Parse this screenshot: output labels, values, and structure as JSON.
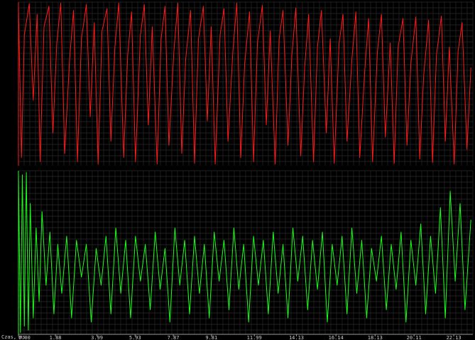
{
  "chart_data": [
    {
      "type": "line",
      "title": "",
      "ylabel": "",
      "xlabel": "Czas, ms",
      "color": "#ff1a1a",
      "xlim": [
        0,
        23.1
      ],
      "ylim": [
        -1,
        1
      ],
      "grid": true,
      "x_ticks": [
        0.0,
        1.88,
        3.99,
        5.93,
        7.87,
        9.81,
        11.99,
        14.13,
        16.14,
        18.13,
        20.11,
        22.13
      ],
      "x_tick_labels": [
        "0.00",
        "1.88",
        "3.99",
        "5.93",
        "7.87",
        "9.81",
        "11.99",
        "14.13",
        "16.14",
        "18.13",
        "20.11",
        "22.13"
      ],
      "series": [
        {
          "x": [
            0.0,
            0.15,
            0.3,
            0.55,
            0.75,
            0.95,
            1.1,
            1.3,
            1.55,
            1.75,
            1.95,
            2.15,
            2.35,
            2.6,
            2.8,
            3.0,
            3.2,
            3.45,
            3.65,
            3.85,
            4.05,
            4.25,
            4.5,
            4.7,
            4.9,
            5.1,
            5.35,
            5.55,
            5.75,
            5.95,
            6.2,
            6.4,
            6.6,
            6.8,
            7.05,
            7.25,
            7.45,
            7.65,
            7.9,
            8.1,
            8.3,
            8.5,
            8.75,
            8.95,
            9.15,
            9.4,
            9.6,
            9.8,
            10.0,
            10.25,
            10.45,
            10.65,
            10.9,
            11.1,
            11.3,
            11.5,
            11.75,
            11.95,
            12.15,
            12.4,
            12.6,
            12.8,
            13.05,
            13.25,
            13.45,
            13.7,
            13.9,
            14.1,
            14.35,
            14.55,
            14.75,
            15.0,
            15.2,
            15.4,
            15.65,
            15.85,
            16.05,
            16.3,
            16.5,
            16.7,
            16.95,
            17.15,
            17.35,
            17.6,
            17.8,
            18.0,
            18.25,
            18.45,
            18.65,
            18.9,
            19.1,
            19.3,
            19.55,
            19.75,
            19.95,
            20.2,
            20.4,
            20.6,
            20.85,
            21.05,
            21.25,
            21.5,
            21.7,
            21.9,
            22.15,
            22.35,
            22.55,
            22.8,
            23.0
          ],
          "y": [
            0.95,
            -0.9,
            0.6,
            0.98,
            -0.2,
            0.85,
            -0.95,
            0.7,
            0.95,
            -0.6,
            0.5,
            0.99,
            -0.85,
            0.3,
            0.9,
            -0.95,
            0.55,
            0.97,
            -0.4,
            0.75,
            -0.98,
            0.65,
            0.92,
            -0.7,
            0.45,
            0.99,
            -0.9,
            0.35,
            0.88,
            -0.95,
            0.6,
            0.97,
            -0.5,
            0.7,
            -0.98,
            0.55,
            0.95,
            -0.75,
            0.4,
            0.99,
            -0.85,
            0.3,
            0.9,
            -0.97,
            0.55,
            0.95,
            -0.45,
            0.7,
            -0.98,
            0.6,
            0.92,
            -0.7,
            0.4,
            0.99,
            -0.9,
            0.25,
            0.88,
            -0.95,
            0.5,
            0.96,
            -0.5,
            0.65,
            -0.98,
            0.55,
            0.9,
            -0.75,
            0.35,
            0.93,
            -0.88,
            0.2,
            0.85,
            -0.95,
            0.45,
            0.9,
            -0.6,
            0.55,
            -0.97,
            0.5,
            0.85,
            -0.7,
            0.3,
            0.88,
            -0.9,
            0.15,
            0.8,
            -0.95,
            0.4,
            0.85,
            -0.65,
            0.5,
            -0.97,
            0.45,
            0.8,
            -0.75,
            0.25,
            0.82,
            -0.92,
            0.1,
            0.78,
            -0.96,
            0.35,
            0.83,
            -0.7,
            0.45,
            -0.98,
            0.4,
            0.75,
            -0.8,
            0.2
          ]
        }
      ]
    },
    {
      "type": "line",
      "title": "",
      "ylabel": "",
      "xlabel": "Czas, ms",
      "color": "#1aff1a",
      "xlim": [
        0,
        23.1
      ],
      "ylim": [
        -1,
        1
      ],
      "grid": true,
      "x_ticks": [
        0.0,
        1.88,
        3.99,
        5.93,
        7.87,
        9.81,
        11.99,
        14.13,
        16.14,
        18.13,
        20.11,
        22.13
      ],
      "x_tick_labels": [
        "0.00",
        "1.88",
        "3.99",
        "5.93",
        "7.87",
        "9.81",
        "11.99",
        "14.13",
        "16.14",
        "18.13",
        "20.11",
        "22.13"
      ],
      "series": [
        {
          "x": [
            0.0,
            0.1,
            0.2,
            0.3,
            0.4,
            0.5,
            0.6,
            0.75,
            0.9,
            1.05,
            1.2,
            1.4,
            1.6,
            1.8,
            2.0,
            2.2,
            2.45,
            2.7,
            2.95,
            3.2,
            3.45,
            3.7,
            3.95,
            4.2,
            4.45,
            4.7,
            4.95,
            5.2,
            5.45,
            5.7,
            5.95,
            6.2,
            6.45,
            6.7,
            6.95,
            7.2,
            7.45,
            7.7,
            7.95,
            8.2,
            8.45,
            8.7,
            8.95,
            9.2,
            9.45,
            9.7,
            9.95,
            10.2,
            10.45,
            10.7,
            10.95,
            11.2,
            11.45,
            11.7,
            11.95,
            12.2,
            12.45,
            12.7,
            12.95,
            13.2,
            13.45,
            13.7,
            13.95,
            14.2,
            14.45,
            14.7,
            14.95,
            15.2,
            15.45,
            15.7,
            15.95,
            16.2,
            16.45,
            16.7,
            16.95,
            17.2,
            17.45,
            17.7,
            17.95,
            18.2,
            18.45,
            18.7,
            18.95,
            19.2,
            19.45,
            19.7,
            19.95,
            20.2,
            20.45,
            20.7,
            20.95,
            21.2,
            21.45,
            21.7,
            21.95,
            22.2,
            22.45,
            22.7,
            23.0
          ],
          "y": [
            0.98,
            -0.98,
            0.95,
            -0.9,
            0.98,
            -0.95,
            0.6,
            -0.8,
            0.3,
            -0.6,
            0.5,
            -0.4,
            0.25,
            -0.75,
            0.1,
            -0.5,
            0.2,
            -0.8,
            0.15,
            -0.3,
            0.1,
            -0.85,
            0.05,
            -0.4,
            0.2,
            -0.75,
            0.3,
            -0.5,
            0.15,
            -0.8,
            0.2,
            -0.35,
            0.1,
            -0.7,
            0.25,
            -0.45,
            0.05,
            -0.85,
            0.3,
            -0.4,
            0.15,
            -0.75,
            0.2,
            -0.5,
            0.1,
            -0.8,
            0.25,
            -0.35,
            0.15,
            -0.7,
            0.3,
            -0.45,
            0.1,
            -0.85,
            0.2,
            -0.4,
            0.15,
            -0.75,
            0.25,
            -0.5,
            0.1,
            -0.8,
            0.3,
            -0.35,
            0.2,
            -0.7,
            0.15,
            -0.45,
            0.25,
            -0.85,
            0.1,
            -0.4,
            0.2,
            -0.75,
            0.3,
            -0.5,
            0.15,
            -0.8,
            0.05,
            -0.35,
            0.2,
            -0.7,
            0.1,
            -0.45,
            0.25,
            -0.85,
            0.15,
            -0.4,
            0.35,
            -0.75,
            0.2,
            -0.5,
            0.55,
            -0.8,
            0.75,
            -0.35,
            0.6,
            -0.7,
            0.4
          ]
        }
      ]
    }
  ]
}
